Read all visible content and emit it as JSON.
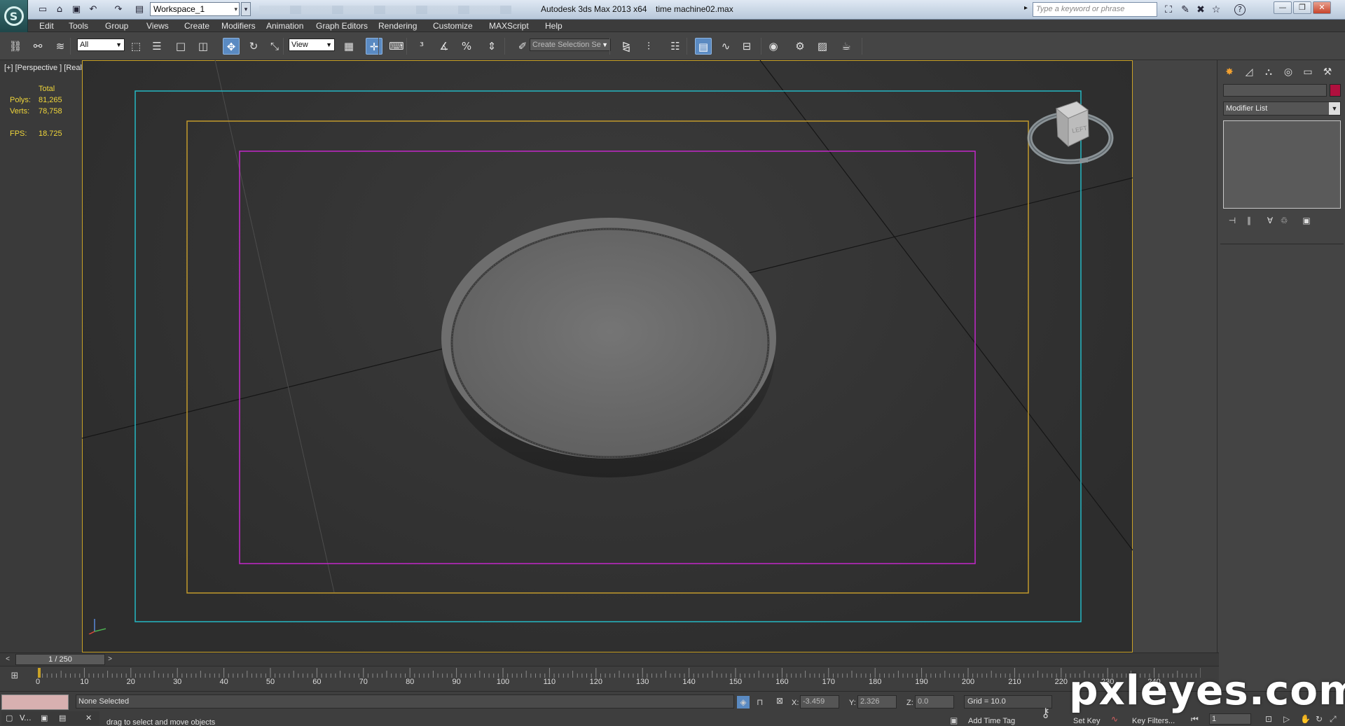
{
  "titlebar": {
    "logo_letter": "S",
    "workspace": "Workspace_1",
    "app_title": "Autodesk 3ds Max  2013 x64",
    "file_title": "time machine02.max",
    "search_placeholder": "Type a keyword or phrase",
    "quick_access": [
      {
        "icon": "new-icon",
        "glyph": "▭"
      },
      {
        "icon": "open-icon",
        "glyph": "⌂"
      },
      {
        "icon": "save-icon",
        "glyph": "▣"
      },
      {
        "icon": "undo-icon",
        "glyph": "↶"
      },
      {
        "icon": "redo-icon",
        "glyph": "↷"
      },
      {
        "icon": "project-folder-icon",
        "glyph": "▤"
      }
    ],
    "info_icons": [
      {
        "icon": "binoculars-icon",
        "glyph": "⛶"
      },
      {
        "icon": "communication-center-icon",
        "glyph": "✎"
      },
      {
        "icon": "exchange-icon",
        "glyph": "✖"
      },
      {
        "icon": "favorites-icon",
        "glyph": "☆"
      },
      {
        "icon": "help-icon",
        "glyph": "?"
      }
    ],
    "window_buttons": [
      {
        "icon": "minimize-icon",
        "glyph": "—"
      },
      {
        "icon": "restore-icon",
        "glyph": "❐"
      },
      {
        "icon": "close-icon",
        "glyph": "✕"
      }
    ]
  },
  "menu": [
    "Edit",
    "Tools",
    "Group",
    "Views",
    "Create",
    "Modifiers",
    "Animation",
    "Graph Editors",
    "Rendering",
    "Customize",
    "MAXScript",
    "Help"
  ],
  "toolbar": {
    "filter": "All",
    "ref_coord": "View",
    "selection_set": "Create Selection Se",
    "buttons": [
      {
        "icon": "select-and-link-icon",
        "glyph": "⛓"
      },
      {
        "icon": "unlink-icon",
        "glyph": "⚯"
      },
      {
        "icon": "bind-space-warp-icon",
        "glyph": "≋"
      },
      {
        "icon": "select-object-icon",
        "glyph": "⬚"
      },
      {
        "icon": "select-by-name-icon",
        "glyph": "☰"
      },
      {
        "icon": "rectangular-selection-icon",
        "glyph": "□"
      },
      {
        "icon": "window-crossing-icon",
        "glyph": "◫"
      },
      {
        "icon": "select-and-move-icon",
        "glyph": "✥"
      },
      {
        "icon": "select-and-rotate-icon",
        "glyph": "↻"
      },
      {
        "icon": "select-and-scale-icon",
        "glyph": "⤡"
      },
      {
        "icon": "pivot-center-icon",
        "glyph": "▦"
      },
      {
        "icon": "select-and-manipulate-icon",
        "glyph": "✛"
      },
      {
        "icon": "keyboard-shortcut-override-icon",
        "glyph": "⌨"
      },
      {
        "icon": "snaps-toggle-icon",
        "glyph": "³"
      },
      {
        "icon": "angle-snap-icon",
        "glyph": "∡"
      },
      {
        "icon": "percent-snap-icon",
        "glyph": "%"
      },
      {
        "icon": "spinner-snap-icon",
        "glyph": "⇕"
      },
      {
        "icon": "edit-named-selection-icon",
        "glyph": "✐"
      },
      {
        "icon": "mirror-icon",
        "glyph": "⧎"
      },
      {
        "icon": "align-icon",
        "glyph": "⫶"
      },
      {
        "icon": "layer-manager-icon",
        "glyph": "☷"
      },
      {
        "icon": "graphite-ribbon-icon",
        "glyph": "▤"
      },
      {
        "icon": "curve-editor-icon",
        "glyph": "∿"
      },
      {
        "icon": "schematic-view-icon",
        "glyph": "⊟"
      },
      {
        "icon": "material-editor-icon",
        "glyph": "◉"
      },
      {
        "icon": "render-setup-icon",
        "glyph": "⚙"
      },
      {
        "icon": "rendered-frame-window-icon",
        "glyph": "▨"
      },
      {
        "icon": "render-production-icon",
        "glyph": "☕"
      }
    ]
  },
  "viewport": {
    "label": "[+] [Perspective ] [Realistic ]",
    "stats": {
      "header": "Total",
      "polys_label": "Polys:",
      "polys": "81,265",
      "verts_label": "Verts:",
      "verts": "78,758",
      "fps_label": "FPS:",
      "fps": "18.725"
    },
    "viewcube_face": "LEFT",
    "frame_colors": {
      "outer": "#c9a227",
      "cyan": "#25b8c4",
      "gold": "#c29a2c",
      "magenta": "#c327c9"
    }
  },
  "command_panel": {
    "tabs": [
      {
        "icon": "create-tab-icon",
        "glyph": "✸"
      },
      {
        "icon": "modify-tab-icon",
        "glyph": "◿"
      },
      {
        "icon": "hierarchy-tab-icon",
        "glyph": "⛬"
      },
      {
        "icon": "motion-tab-icon",
        "glyph": "◎"
      },
      {
        "icon": "display-tab-icon",
        "glyph": "▭"
      },
      {
        "icon": "utilities-tab-icon",
        "glyph": "⚒"
      }
    ],
    "modifier_list": "Modifier List",
    "color_swatch": "#b0103e",
    "stack_buttons": [
      {
        "icon": "pin-stack-icon",
        "glyph": "⊣"
      },
      {
        "icon": "show-end-result-icon",
        "glyph": "∥"
      },
      {
        "icon": "make-unique-icon",
        "glyph": "∀"
      },
      {
        "icon": "remove-modifier-icon",
        "glyph": "♲"
      },
      {
        "icon": "configure-modifier-sets-icon",
        "glyph": "▣"
      }
    ]
  },
  "time_slider": {
    "label": "1 / 250",
    "prev": "<",
    "next": ">"
  },
  "trackbar": {
    "ticks": [
      0,
      10,
      20,
      30,
      40,
      50,
      60,
      70,
      80,
      90,
      100,
      110,
      120,
      130,
      140,
      150,
      160,
      170,
      180,
      190,
      200,
      210,
      220,
      230,
      240
    ],
    "max_frame": 250
  },
  "status": {
    "selection": "None Selected",
    "prompt": "drag to select and move objects",
    "x_label": "X:",
    "x": "-3.459",
    "y_label": "Y:",
    "y": "2.326",
    "z_label": "Z:",
    "z": "0.0",
    "grid": "Grid = 10.0",
    "add_time_tag": "Add Time Tag",
    "set_key": "Set Key",
    "key_filters": "Key Filters...",
    "frame": "1",
    "mini_tab": "V..."
  },
  "watermark": "pxleyes.com"
}
